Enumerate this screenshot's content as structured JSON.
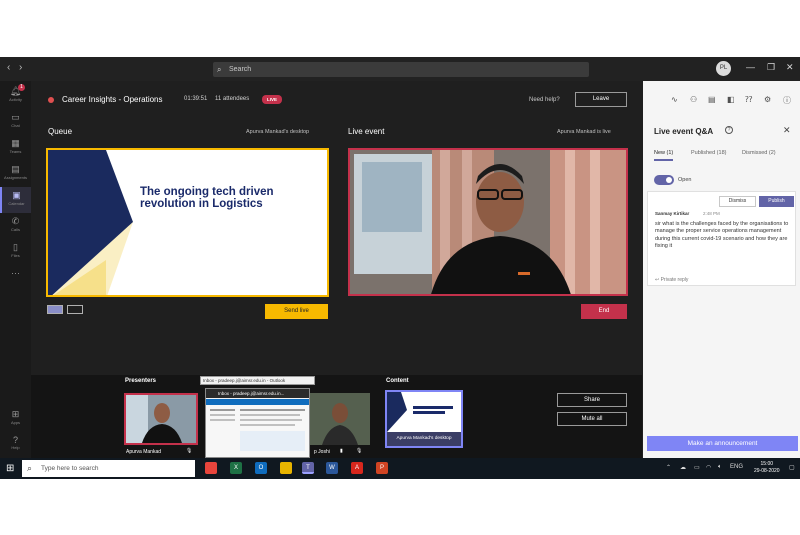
{
  "titlebar": {
    "back": "‹",
    "forward": "›",
    "search_placeholder": "Search",
    "avatar_initials": "PL",
    "window_controls": [
      "—",
      "❐",
      "✕"
    ]
  },
  "rail": {
    "items": [
      {
        "label": "Activity",
        "icon": "bell-icon",
        "glyph": "🔔︎",
        "badge": "1"
      },
      {
        "label": "Chat",
        "icon": "chat-icon",
        "glyph": "▭"
      },
      {
        "label": "Teams",
        "icon": "teams-icon",
        "glyph": "▦"
      },
      {
        "label": "Assignments",
        "icon": "assignments-icon",
        "glyph": "▤"
      },
      {
        "label": "Calendar",
        "icon": "calendar-icon",
        "glyph": "▣",
        "active": true
      },
      {
        "label": "Calls",
        "icon": "phone-icon",
        "glyph": "✆"
      },
      {
        "label": "Files",
        "icon": "files-icon",
        "glyph": "▯"
      },
      {
        "label": "",
        "icon": "more-icon",
        "glyph": "···"
      },
      {
        "label": "Apps",
        "icon": "apps-icon",
        "glyph": "⊞"
      },
      {
        "label": "Help",
        "icon": "help-icon",
        "glyph": "?"
      }
    ]
  },
  "header": {
    "title": "Career Insights - Operations",
    "timer": "01:39:51",
    "attendees": "11 attendees",
    "live_badge": "LIVE",
    "need_help": "Need help?",
    "leave": "Leave"
  },
  "queue": {
    "label": "Queue",
    "source": "Apurva Mankad's desktop",
    "slide_text": "The ongoing tech driven revolution in Logistics",
    "send_live": "Send live"
  },
  "live": {
    "label": "Live event",
    "status": "Apurva Mankad is live",
    "end": "End"
  },
  "bottom": {
    "presenters_label": "Presenters",
    "presenter_1": "Apurva Mankad",
    "presenter_2": "p Joshi",
    "content_label": "Content",
    "content_tile": "Apurva Mankad's desktop",
    "share": "Share",
    "mute_all": "Mute all",
    "tooltip": "Inbox - pradeep.j@aimsr.edu.in - Outlook",
    "thumb_title": "Inbox - pradeep.j@aimsr.edu.in..."
  },
  "qa": {
    "title": "Live event Q&A",
    "tabs": [
      "New (1)",
      "Published (18)",
      "Dismissed (2)"
    ],
    "open_label": "Open",
    "dismiss": "Dismiss",
    "publish": "Publish",
    "question": {
      "author": "Sanmay Kirtikar",
      "time": "2:48 PM",
      "text": "sir what is the challenges faced by the organisations to manage the proper service operations management during this current covid-19 scenario and how they are fixing it",
      "reply": "Private reply"
    },
    "make_announcement": "Make an announcement"
  },
  "taskbar": {
    "search_placeholder": "Type here to search",
    "apps": [
      {
        "icon": "chrome-icon",
        "color": "#e8453c"
      },
      {
        "icon": "excel-icon",
        "color": "#1e7145"
      },
      {
        "icon": "outlook-icon",
        "color": "#0f6cbd"
      },
      {
        "icon": "explorer-icon",
        "color": "#e8b400"
      },
      {
        "icon": "folder-icon",
        "color": "#6b6b6b"
      },
      {
        "icon": "teams-icon",
        "color": "#6264a7"
      },
      {
        "icon": "word-icon",
        "color": "#2b579a"
      },
      {
        "icon": "acrobat-icon",
        "color": "#d7271d"
      },
      {
        "icon": "powerpoint-icon",
        "color": "#d04423"
      }
    ],
    "lang": "ENG",
    "time": "15:00",
    "date": "29-08-2020"
  },
  "colors": {
    "accent": "#6264a7",
    "queue_border": "#f7b900",
    "live_border": "#c4314b",
    "announce": "#7f85f5"
  }
}
